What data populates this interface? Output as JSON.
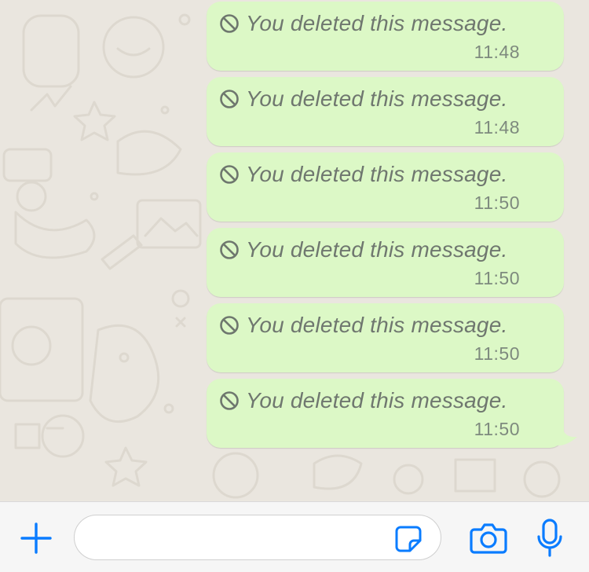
{
  "chat": {
    "messages": [
      {
        "text": "You deleted this message.",
        "time": "11:48"
      },
      {
        "text": "You deleted this message.",
        "time": "11:48"
      },
      {
        "text": "You deleted this message.",
        "time": "11:50"
      },
      {
        "text": "You deleted this message.",
        "time": "11:50"
      },
      {
        "text": "You deleted this message.",
        "time": "11:50"
      },
      {
        "text": "You deleted this message.",
        "time": "11:50"
      }
    ]
  },
  "composer": {
    "value": "",
    "placeholder": ""
  },
  "icons": {
    "deleted": "ban-icon",
    "attach": "plus-icon",
    "sticker": "sticker-icon",
    "camera": "camera-icon",
    "microphone": "microphone-icon"
  },
  "colors": {
    "outgoing_bubble": "#DCF8C6",
    "chat_background": "#EAE6DF",
    "accent": "#0A7CFF",
    "input_bar": "#F6F6F6"
  }
}
